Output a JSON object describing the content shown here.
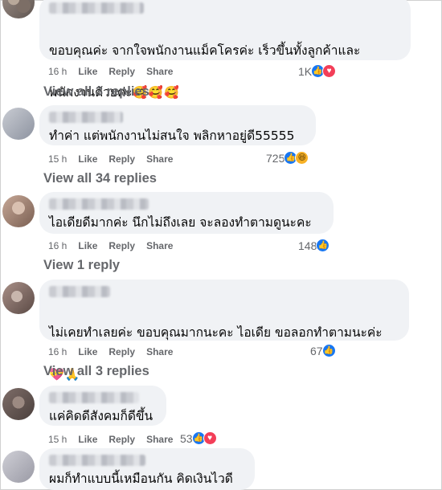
{
  "actions": {
    "like": "Like",
    "reply": "Reply",
    "share": "Share"
  },
  "comments": [
    {
      "text_line1": "ขอบคุณค่ะ จากใจพนักงานแม็คโครค่ะ เร็วขึ้นทั้งลูกค้าและ",
      "text_line2": "พนักงานด้วยค่ะ",
      "emoji": "🥰🥰🥰",
      "time": "16 h",
      "reaction_count": "1K",
      "reactions": [
        "like-icon",
        "love-icon"
      ],
      "view_replies": "View all 3 replies"
    },
    {
      "text_line1": "ทำค่า แต่พนักงานไม่สนใจ พลิกหาอยู่ดี55555",
      "time": "15 h",
      "reaction_count": "725",
      "reactions": [
        "like-icon",
        "haha-icon"
      ],
      "view_replies": "View all 34 replies"
    },
    {
      "text_line1": "ไอเดียดีมากค่ะ นึกไม่ถึงเลย จะลองทำตามดูนะคะ",
      "time": "16 h",
      "reaction_count": "148",
      "reactions": [
        "like-icon"
      ],
      "view_replies": "View 1 reply"
    },
    {
      "text_line1": "ไม่เคยทำเลยค่ะ ขอบคุณมากนะคะ ไอเดีย ขอลอกทำตามนะค่ะ",
      "emoji": "💝🙏",
      "time": "16 h",
      "reaction_count": "67",
      "reactions": [
        "like-icon"
      ],
      "view_replies": "View all 3 replies"
    },
    {
      "text_line1": "แค่คิดดีสังคมก็ดีขึ้น",
      "time": "15 h",
      "reaction_count": "53",
      "reactions": [
        "like-icon",
        "love-icon"
      ]
    },
    {
      "text_line1": "ผมก็ทำแบบนี้เหมือนกัน คิดเงินไวดี"
    }
  ]
}
